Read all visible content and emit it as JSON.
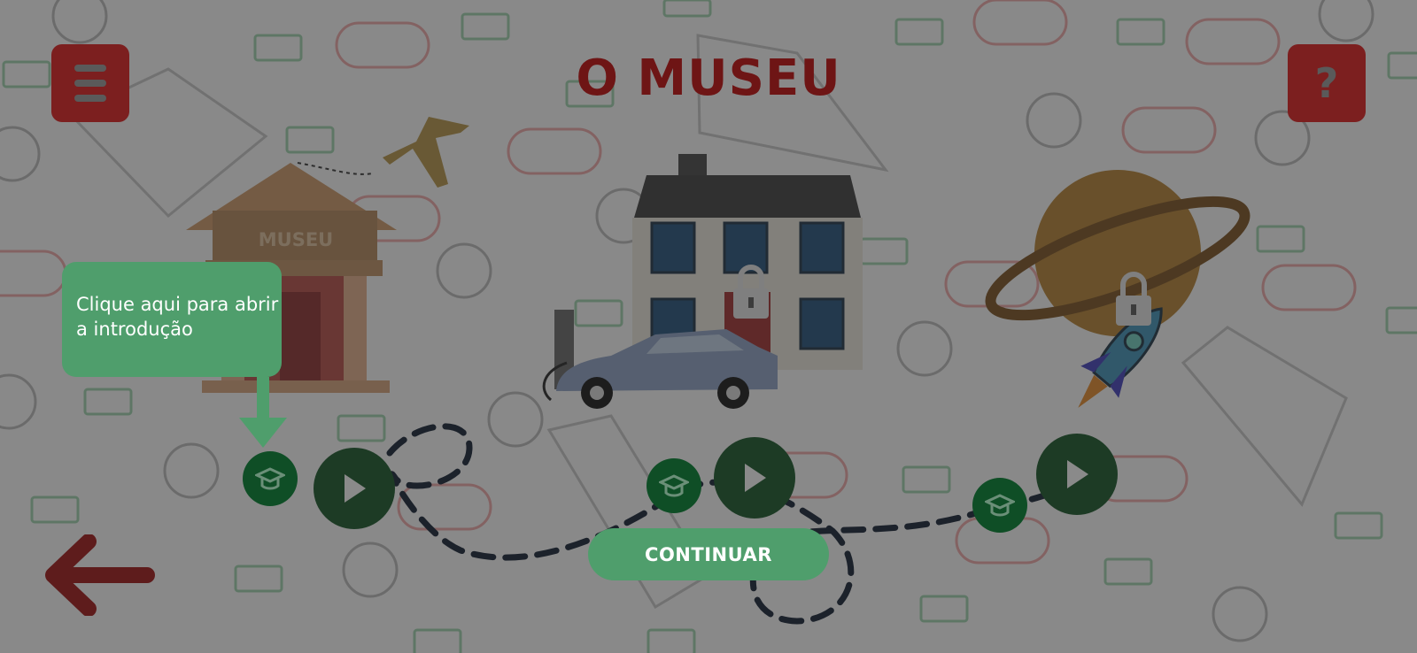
{
  "title": "O MUSEU",
  "tooltip": {
    "text": "Clique aqui para abrir a introdução"
  },
  "continue_label": "CONTINUAR",
  "museum_sign": "MUSEU",
  "icons": {
    "menu": "hamburger-menu-icon",
    "help": "question-mark-icon",
    "back": "left-arrow-icon",
    "play": "play-icon",
    "intro": "graduation-cap-icon",
    "lock": "padlock-icon"
  },
  "levels": [
    {
      "scene": "museum",
      "locked": false
    },
    {
      "scene": "house-and-car",
      "locked": true
    },
    {
      "scene": "planet-and-rocket",
      "locked": true
    }
  ],
  "colors": {
    "menu_button": "#7c1f1f",
    "accent_green": "#4f9e6c",
    "play_button": "#1d3b25",
    "cap_button": "#0f4e26",
    "title": "#6e1515"
  }
}
